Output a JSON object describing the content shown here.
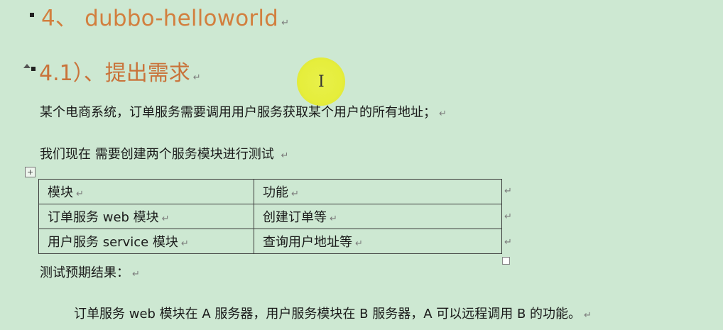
{
  "heading_1": {
    "text": "4、 dubbo-helloworld",
    "mark": "↵"
  },
  "heading_2": {
    "text": "4.1）、提出需求",
    "mark": "↵"
  },
  "paragraphs": {
    "requirement": {
      "text": "某个电商系统，订单服务需要调用用户服务获取某个用户的所有地址；",
      "mark": "↵"
    },
    "plan": {
      "text": "我们现在 需要创建两个服务模块进行测试 ",
      "mark": "↵"
    },
    "expected_label": {
      "text": "测试预期结果：",
      "mark": "↵"
    },
    "expected_result": {
      "text": "订单服务 web 模块在 A 服务器，用户服务模块在 B 服务器，A 可以远程调用 B 的功能。",
      "mark": "↵"
    }
  },
  "table": {
    "anchor_glyph": "+",
    "rows": [
      {
        "module": "模块",
        "function": "功能"
      },
      {
        "module": "订单服务 web 模块",
        "function": "创建订单等"
      },
      {
        "module": "用户服务 service 模块",
        "function": "查询用户地址等"
      }
    ],
    "cell_mark": "↵",
    "row_mark": "↵"
  },
  "cursor": {
    "glyph": "I"
  },
  "colors": {
    "page_background": "#cde8d2",
    "heading": "#d27f3e",
    "body_text": "#1a1a1a",
    "cursor_highlight": "#e6ee3c"
  }
}
